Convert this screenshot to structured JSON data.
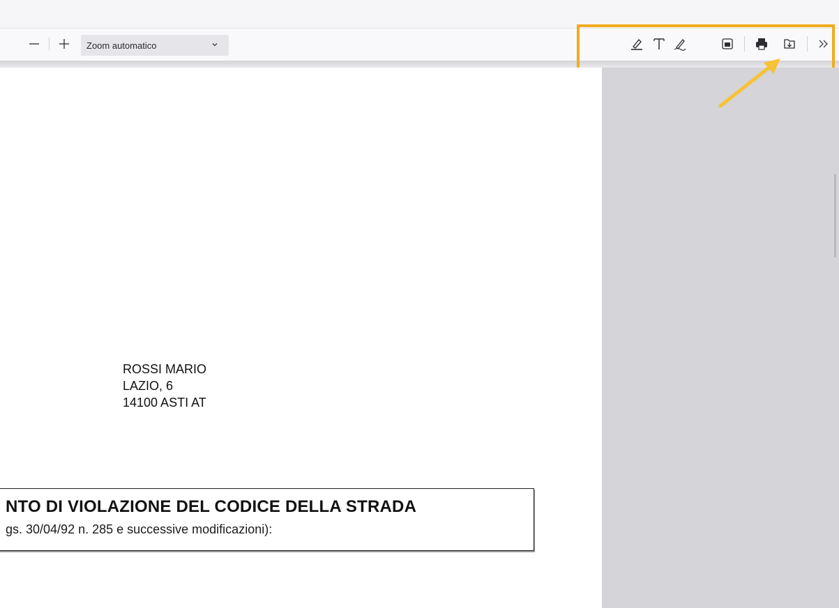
{
  "toolbar": {
    "zoom_out_label": "—",
    "zoom_in_label": "+",
    "zoom_value": "Zoom automatico",
    "more_tools_label": "»",
    "tools": [
      "highlight-icon",
      "text-icon",
      "draw-icon",
      "image-icon",
      "print-icon",
      "save-icon"
    ]
  },
  "document": {
    "recipient": {
      "name": "ROSSI MARIO",
      "street": "LAZIO, 6",
      "city": "14100 ASTI AT"
    },
    "notice": {
      "title": "NTO DI VIOLAZIONE DEL CODICE DELLA STRADA",
      "subtitle": "gs. 30/04/92 n. 285 e successive modificazioni):"
    }
  },
  "colors": {
    "highlight": "#f2ab1e",
    "toolbar_bg": "#f9f9fb",
    "side_panel": "#d4d4d9"
  }
}
